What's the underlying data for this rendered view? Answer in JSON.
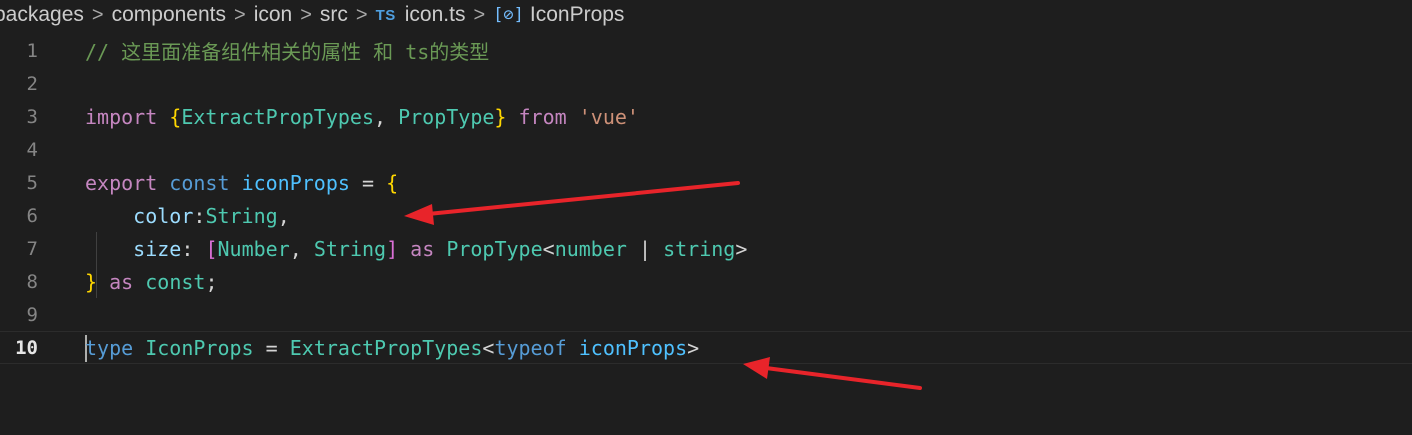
{
  "breadcrumb": {
    "parts": [
      "packages",
      "components",
      "icon",
      "src",
      "icon.ts",
      "IconProps"
    ],
    "file_badge": "TS",
    "symbol_icon": "[⊘]",
    "separator": ">"
  },
  "editor": {
    "line_numbers": [
      "1",
      "2",
      "3",
      "4",
      "5",
      "6",
      "7",
      "8",
      "9",
      "10"
    ],
    "active_line": "10",
    "lines": {
      "l1": {
        "comment": "// 这里面准备组件相关的属性 和 ts的类型"
      },
      "l3": {
        "import": "import",
        "brace_open": "{",
        "t1": "ExtractPropTypes",
        "comma": ", ",
        "t2": "PropType",
        "brace_close": "}",
        "from": "from",
        "module": "'vue'"
      },
      "l5": {
        "export": "export",
        "const": "const",
        "name": "iconProps",
        "eq": "=",
        "brace": "{"
      },
      "l6": {
        "key": "color",
        "colon": ":",
        "type": "String",
        "comma": ","
      },
      "l7": {
        "key": "size",
        "colon": ":",
        "br_open": "[",
        "t1": "Number",
        "comma": ", ",
        "t2": "String",
        "br_close": "]",
        "as": "as",
        "proptype": "PropType",
        "lt": "<",
        "num": "number",
        "pipe": "|",
        "str": "string",
        "gt": ">"
      },
      "l8": {
        "brace": "}",
        "as": "as",
        "const": "const",
        "semi": ";"
      },
      "l10": {
        "type_kw": "type",
        "name": "IconProps",
        "eq": "=",
        "util": "ExtractPropTypes",
        "lt": "<",
        "typeof": "typeof",
        "ref": "iconProps",
        "gt": ">"
      }
    }
  },
  "annotations": {
    "arrow_color": "#e8242a"
  }
}
